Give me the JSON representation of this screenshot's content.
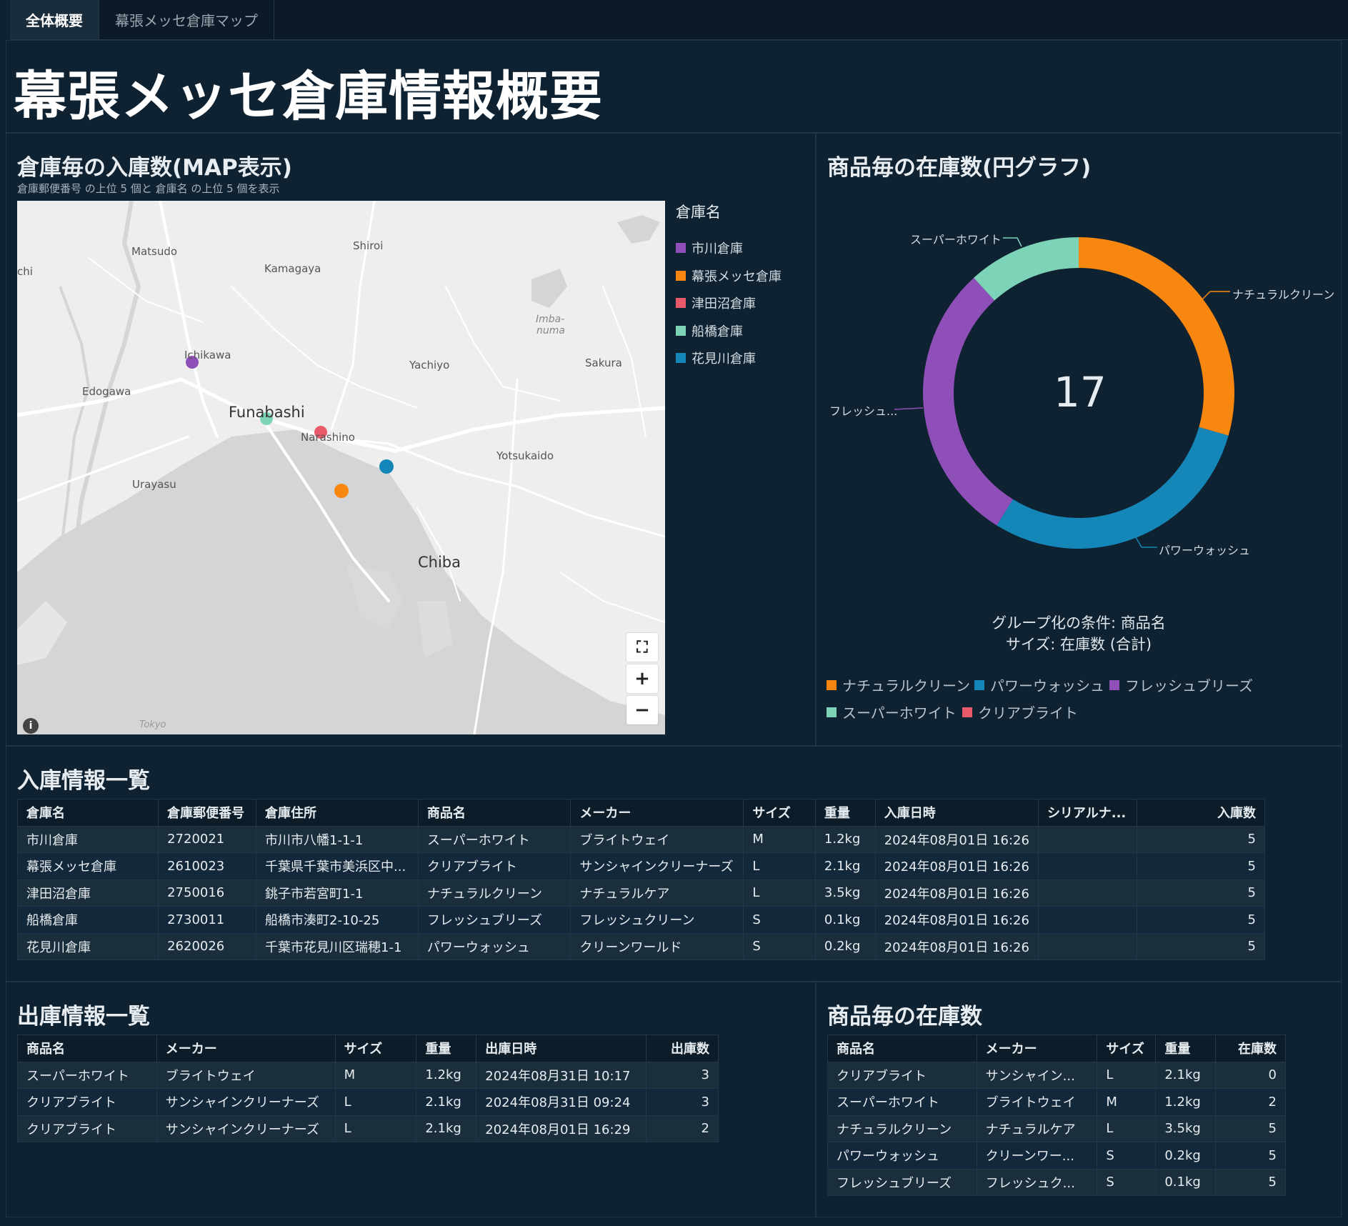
{
  "tabs": [
    {
      "label": "全体概要",
      "active": true
    },
    {
      "label": "幕張メッセ倉庫マップ",
      "active": false
    }
  ],
  "page_title": "幕張メッセ倉庫情報概要",
  "map_panel": {
    "title": "倉庫毎の入庫数(MAP表示)",
    "subtitle": "倉庫郵便番号 の上位 5 個と 倉庫名 の上位 5 個を表示",
    "place_labels": [
      "Matsudo",
      "Shiroi",
      "Kamagaya",
      "chi",
      "Imba-",
      "numa",
      "Ichikawa",
      "Yachiyo",
      "Sakura",
      "Edogawa",
      "Funabashi",
      "Narashino",
      "Yotsukaido",
      "Urayasu",
      "Chiba",
      "Tokyo"
    ],
    "buttons": {
      "recenter": "⛶",
      "zoom_in": "+",
      "zoom_out": "−",
      "info": "i"
    },
    "legend_title": "倉庫名",
    "legend": [
      {
        "label": "市川倉庫",
        "color": "#8e4fb8"
      },
      {
        "label": "幕張メッセ倉庫",
        "color": "#f7870f"
      },
      {
        "label": "津田沼倉庫",
        "color": "#e85a6a"
      },
      {
        "label": "船橋倉庫",
        "color": "#7dd3b8"
      },
      {
        "label": "花見川倉庫",
        "color": "#1486b8"
      }
    ]
  },
  "pie_panel": {
    "title": "商品毎の在庫数(円グラフ)",
    "total": "17",
    "group_by": "グループ化の条件: 商品名",
    "size_by": "サイズ: 在庫数 (合計)",
    "slice_labels": [
      "スーパーホワイト",
      "ナチュラルクリーン",
      "フレッシュ...",
      "パワーウォッシュ"
    ],
    "legend": [
      {
        "label": "ナチュラルクリーン",
        "color": "#f7870f"
      },
      {
        "label": "パワーウォッシュ",
        "color": "#1486b8"
      },
      {
        "label": "フレッシュブリーズ",
        "color": "#8e4fb8"
      },
      {
        "label": "スーパーホワイト",
        "color": "#7dd3b8"
      },
      {
        "label": "クリアブライト",
        "color": "#e85a6a"
      }
    ]
  },
  "chart_data": {
    "type": "pie",
    "categories": [
      "ナチュラルクリーン",
      "パワーウォッシュ",
      "フレッシュブリーズ",
      "スーパーホワイト",
      "クリアブライト"
    ],
    "values": [
      5,
      5,
      5,
      2,
      0
    ],
    "colors": [
      "#f7870f",
      "#1486b8",
      "#8e4fb8",
      "#7dd3b8",
      "#e85a6a"
    ],
    "total": 17
  },
  "inbound": {
    "title": "入庫情報一覧",
    "columns": [
      "倉庫名",
      "倉庫郵便番号",
      "倉庫住所",
      "商品名",
      "メーカー",
      "サイズ",
      "重量",
      "入庫日時",
      "シリアルナ...",
      "入庫数"
    ],
    "rows": [
      [
        "市川倉庫",
        "2720021",
        "市川市八幡1-1-1",
        "スーパーホワイト",
        "ブライトウェイ",
        "M",
        "1.2kg",
        "2024年08月01日 16:26",
        "",
        "5"
      ],
      [
        "幕張メッセ倉庫",
        "2610023",
        "千葉県千葉市美浜区中...",
        "クリアブライト",
        "サンシャインクリーナーズ",
        "L",
        "2.1kg",
        "2024年08月01日 16:26",
        "",
        "5"
      ],
      [
        "津田沼倉庫",
        "2750016",
        "銚子市若宮町1-1",
        "ナチュラルクリーン",
        "ナチュラルケア",
        "L",
        "3.5kg",
        "2024年08月01日 16:26",
        "",
        "5"
      ],
      [
        "船橋倉庫",
        "2730011",
        "船橋市湊町2-10-25",
        "フレッシュブリーズ",
        "フレッシュクリーン",
        "S",
        "0.1kg",
        "2024年08月01日 16:26",
        "",
        "5"
      ],
      [
        "花見川倉庫",
        "2620026",
        "千葉市花見川区瑞穂1-1",
        "パワーウォッシュ",
        "クリーンワールド",
        "S",
        "0.2kg",
        "2024年08月01日 16:26",
        "",
        "5"
      ]
    ]
  },
  "outbound": {
    "title": "出庫情報一覧",
    "columns": [
      "商品名",
      "メーカー",
      "サイズ",
      "重量",
      "出庫日時",
      "出庫数"
    ],
    "rows": [
      [
        "スーパーホワイト",
        "ブライトウェイ",
        "M",
        "1.2kg",
        "2024年08月31日 10:17",
        "3"
      ],
      [
        "クリアブライト",
        "サンシャインクリーナーズ",
        "L",
        "2.1kg",
        "2024年08月31日 09:24",
        "3"
      ],
      [
        "クリアブライト",
        "サンシャインクリーナーズ",
        "L",
        "2.1kg",
        "2024年08月01日 16:29",
        "2"
      ]
    ]
  },
  "stock": {
    "title": "商品毎の在庫数",
    "columns": [
      "商品名",
      "メーカー",
      "サイズ",
      "重量",
      "在庫数"
    ],
    "rows": [
      [
        "クリアブライト",
        "サンシャイン...",
        "L",
        "2.1kg",
        "0"
      ],
      [
        "スーパーホワイト",
        "ブライトウェイ",
        "M",
        "1.2kg",
        "2"
      ],
      [
        "ナチュラルクリーン",
        "ナチュラルケア",
        "L",
        "3.5kg",
        "5"
      ],
      [
        "パワーウォッシュ",
        "クリーンワー...",
        "S",
        "0.2kg",
        "5"
      ],
      [
        "フレッシュブリーズ",
        "フレッシュク...",
        "S",
        "0.1kg",
        "5"
      ]
    ]
  }
}
